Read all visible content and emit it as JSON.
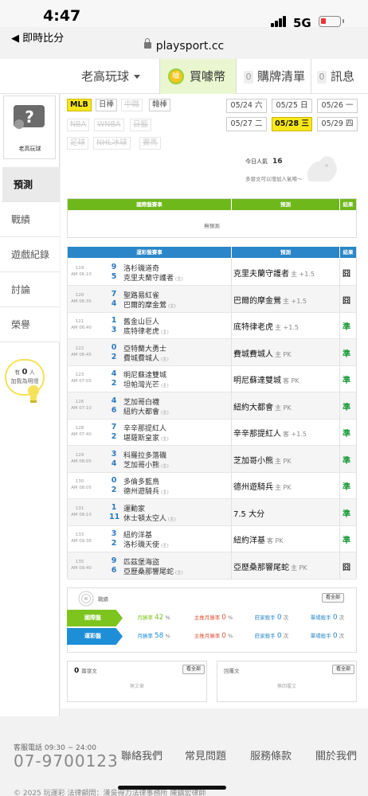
{
  "status_bar": {
    "time": "4:47",
    "back_label": "◀ 即時比分",
    "network": "5G"
  },
  "browser": {
    "url": "playsport.cc"
  },
  "top_nav": {
    "category": "老高玩球",
    "buy_coin": "買噱幣",
    "buy_list_count": "0",
    "buy_list": "購牌清單",
    "msg_count": "0",
    "messages": "訊息"
  },
  "profile": {
    "username": "老高玩球"
  },
  "sidebar": {
    "items": [
      "預測",
      "戰績",
      "遊戲紀錄",
      "討論",
      "榮譽"
    ],
    "active": "預測",
    "fans_prefix": "有",
    "fans_count": "0",
    "fans_suffix": "人",
    "fans_text": "加我為明燈"
  },
  "leagues": [
    {
      "label": "MLB",
      "state": "selected"
    },
    {
      "label": "日棒",
      "state": "normal"
    },
    {
      "label": "中職",
      "state": "disabled"
    },
    {
      "label": "韓棒",
      "state": "normal"
    },
    {
      "label": "NBA",
      "state": "disabled"
    },
    {
      "label": "WNBA",
      "state": "disabled"
    },
    {
      "label": "日籃",
      "state": "disabled"
    },
    {
      "label": "足球",
      "state": "disabled"
    },
    {
      "label": "NHL冰球",
      "state": "disabled"
    },
    {
      "label": "賽馬",
      "state": "disabled"
    }
  ],
  "dates": [
    {
      "label": "05/24 六",
      "selected": false
    },
    {
      "label": "05/25 日",
      "selected": false
    },
    {
      "label": "05/26 一",
      "selected": false
    },
    {
      "label": "05/27 二",
      "selected": false
    },
    {
      "label": "05/28 三",
      "selected": true
    },
    {
      "label": "05/29 四",
      "selected": false
    }
  ],
  "popularity": {
    "label": "今日人氣",
    "value": "16",
    "note": "多發文可以增加人氣唷～"
  },
  "intl_table": {
    "header_game": "國際盤賽事",
    "header_pred": "預測",
    "header_result": "結果",
    "empty": "無預測"
  },
  "lottery_table": {
    "header_game": "運彩盤賽事",
    "header_pred": "預測",
    "header_result": "結果"
  },
  "games": [
    {
      "no": "119",
      "time": "AM 06:10",
      "s1": "9",
      "t1": "洛杉磯道奇",
      "s2": "5",
      "t2": "克里夫蘭守護者",
      "home_mark": "(主)",
      "pick": "克里夫蘭守護者",
      "side": "主",
      "line": "+1.5",
      "result": "囧",
      "rc": "#333333"
    },
    {
      "no": "120",
      "time": "AM 06:35",
      "s1": "7",
      "t1": "聖路易紅雀",
      "s2": "4",
      "t2": "巴爾的摩金鶯",
      "home_mark": "(主)",
      "pick": "巴爾的摩金鶯",
      "side": "主",
      "line": "+1.5",
      "result": "囧",
      "rc": "#333333"
    },
    {
      "no": "121",
      "time": "AM 06:40",
      "s1": "1",
      "t1": "舊金山巨人",
      "s2": "3",
      "t2": "底特律老虎",
      "home_mark": "(主)",
      "pick": "底特律老虎",
      "side": "主",
      "line": "+1.5",
      "result": "準",
      "rc": "#1a9a3a"
    },
    {
      "no": "122",
      "time": "AM 06:45",
      "s1": "0",
      "t1": "亞特蘭大勇士",
      "s2": "2",
      "t2": "費城費城人",
      "home_mark": "(主)",
      "pick": "費城費城人",
      "side": "主",
      "line": "PK",
      "result": "準",
      "rc": "#1a9a3a"
    },
    {
      "no": "123",
      "time": "AM 07:05",
      "s1": "4",
      "t1": "明尼蘇達雙城",
      "s2": "2",
      "t2": "坦帕灣光芒",
      "home_mark": "(主)",
      "pick": "明尼蘇達雙城",
      "side": "客",
      "line": "PK",
      "result": "準",
      "rc": "#1a9a3a"
    },
    {
      "no": "126",
      "time": "AM 07:10",
      "s1": "4",
      "t1": "芝加哥白襪",
      "s2": "6",
      "t2": "紐約大都會",
      "home_mark": "(主)",
      "pick": "紐約大都會",
      "side": "主",
      "line": "PK",
      "result": "準",
      "rc": "#1a9a3a"
    },
    {
      "no": "128",
      "time": "AM 07:40",
      "s1": "7",
      "t1": "辛辛那提紅人",
      "s2": "2",
      "t2": "堪薩斯皇家",
      "home_mark": "(主)",
      "pick": "辛辛那提紅人",
      "side": "客",
      "line": "+1.5",
      "result": "準",
      "rc": "#1a9a3a"
    },
    {
      "no": "129",
      "time": "AM 08:05",
      "s1": "3",
      "t1": "科羅拉多落磯",
      "s2": "4",
      "t2": "芝加哥小熊",
      "home_mark": "(主)",
      "pick": "芝加哥小熊",
      "side": "主",
      "line": "PK",
      "result": "準",
      "rc": "#1a9a3a"
    },
    {
      "no": "130",
      "time": "AM 08:05",
      "s1": "0",
      "t1": "多倫多藍鳥",
      "s2": "2",
      "t2": "德州遊騎兵",
      "home_mark": "(主)",
      "pick": "德州遊騎兵",
      "side": "主",
      "line": "PK",
      "result": "準",
      "rc": "#1a9a3a"
    },
    {
      "no": "131",
      "time": "AM 08:10",
      "s1": "1",
      "t1": "運動家",
      "s2": "11",
      "t2": "休士頓太空人",
      "home_mark": "(主)",
      "pick": "7.5 大分",
      "side": "",
      "line": "",
      "result": "準",
      "rc": "#1a9a3a"
    },
    {
      "no": "133",
      "time": "AM 09:38",
      "s1": "3",
      "t1": "紐約洋基",
      "s2": "2",
      "t2": "洛杉磯天使",
      "home_mark": "(主)",
      "pick": "紐約洋基",
      "side": "客",
      "line": "PK",
      "result": "準",
      "rc": "#1a9a3a"
    },
    {
      "no": "135",
      "time": "AM 09:40",
      "s1": "9",
      "t1": "匹茲堡海盜",
      "s2": "6",
      "t2": "亞歷桑那響尾蛇",
      "home_mark": "(主)",
      "pick": "亞歷桑那響尾蛇",
      "side": "主",
      "line": "PK",
      "result": "囧",
      "rc": "#333333"
    }
  ],
  "record": {
    "title": "戰績",
    "view_all": "看全部",
    "rows": [
      {
        "label": "國際盤",
        "color": "#7dc41e",
        "win_rate_label": "月勝率",
        "win_rate": "42",
        "main_label": "主推月勝率",
        "main_rate": "0",
        "killer_label": "莊家殺手",
        "killer": "0",
        "single_label": "單場殺手",
        "single": "0"
      },
      {
        "label": "運彩盤",
        "color": "#1e8fd6",
        "win_rate_label": "月勝率",
        "win_rate": "58",
        "main_label": "主推月勝率",
        "main_rate": "0",
        "killer_label": "莊家殺手",
        "killer": "0",
        "single_label": "單場殺手",
        "single": "0"
      }
    ],
    "unit_pct": "%",
    "unit_times": "次"
  },
  "posts": {
    "count": "0",
    "label": "篇發文",
    "view_all": "看全部",
    "empty": "無文章"
  },
  "replies": {
    "label": "回覆文",
    "view_all": "看全部",
    "empty": "無回覆文"
  },
  "footer": {
    "hours": "客服電話 09:30 ~ 24:00",
    "phone": "07-9700123",
    "links": [
      "聯絡我們",
      "常見問題",
      "服務條款",
      "關於我們"
    ],
    "copyright": "© 2025 玩運彩  法律顧問：漢吳得力法律事務所 陳鎮宏律師"
  }
}
